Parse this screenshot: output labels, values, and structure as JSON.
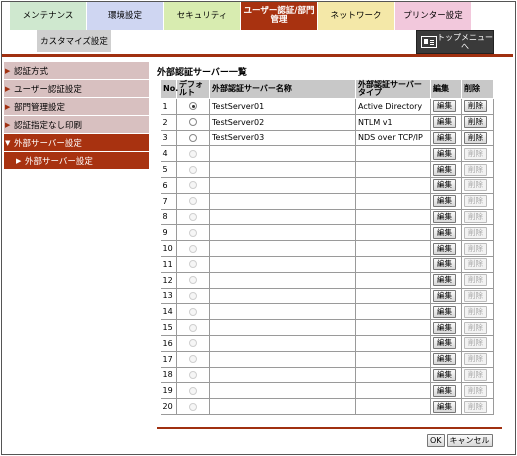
{
  "tabs": [
    {
      "label": "メンテナンス",
      "color": "#cfe8cf",
      "width": 77,
      "active": false
    },
    {
      "label": "環境設定",
      "color": "#cfd6f2",
      "width": 77,
      "active": false
    },
    {
      "label": "セキュリティ",
      "color": "#d8ecb0",
      "width": 77,
      "active": false
    },
    {
      "label": "ユーザー認証/部門\n管理",
      "color": "#a83210",
      "width": 77,
      "active": true
    },
    {
      "label": "ネットワーク",
      "color": "#f4e8a8",
      "width": 77,
      "active": false
    },
    {
      "label": "プリンター設定",
      "color": "#f2c8dc",
      "width": 77,
      "active": false
    }
  ],
  "subtab": {
    "label": "カスタマイズ設定"
  },
  "top_menu": {
    "label": "トップメニュー\nへ"
  },
  "sidebar": {
    "items": [
      {
        "label": "認証方式",
        "arrow": "▶",
        "state": ""
      },
      {
        "label": "ユーザー認証設定",
        "arrow": "▶",
        "state": ""
      },
      {
        "label": "部門管理設定",
        "arrow": "▶",
        "state": ""
      },
      {
        "label": "認証指定なし印刷",
        "arrow": "▶",
        "state": ""
      },
      {
        "label": "外部サーバー設定",
        "arrow": "▼",
        "state": "open"
      },
      {
        "label": "外部サーバー設定",
        "arrow": "▶",
        "state": "sub"
      }
    ]
  },
  "main": {
    "title": "外部認証サーバー一覧",
    "columns": [
      "No.",
      "デフォ\nルト",
      "外部認証サーバー名称",
      "外部認証サーバー\nタイプ",
      "編集",
      "削除"
    ],
    "edit_label": "編集",
    "delete_label": "削除",
    "rows": [
      {
        "no": "1",
        "default": true,
        "name": "TestServer01",
        "type": "Active Directory",
        "enabled": true
      },
      {
        "no": "2",
        "default": false,
        "name": "TestServer02",
        "type": "NTLM v1",
        "enabled": true
      },
      {
        "no": "3",
        "default": false,
        "name": "TestServer03",
        "type": "NDS over TCP/IP",
        "enabled": true
      },
      {
        "no": "4",
        "default": false,
        "name": "",
        "type": "",
        "enabled": false
      },
      {
        "no": "5",
        "default": false,
        "name": "",
        "type": "",
        "enabled": false
      },
      {
        "no": "6",
        "default": false,
        "name": "",
        "type": "",
        "enabled": false
      },
      {
        "no": "7",
        "default": false,
        "name": "",
        "type": "",
        "enabled": false
      },
      {
        "no": "8",
        "default": false,
        "name": "",
        "type": "",
        "enabled": false
      },
      {
        "no": "9",
        "default": false,
        "name": "",
        "type": "",
        "enabled": false
      },
      {
        "no": "10",
        "default": false,
        "name": "",
        "type": "",
        "enabled": false
      },
      {
        "no": "11",
        "default": false,
        "name": "",
        "type": "",
        "enabled": false
      },
      {
        "no": "12",
        "default": false,
        "name": "",
        "type": "",
        "enabled": false
      },
      {
        "no": "13",
        "default": false,
        "name": "",
        "type": "",
        "enabled": false
      },
      {
        "no": "14",
        "default": false,
        "name": "",
        "type": "",
        "enabled": false
      },
      {
        "no": "15",
        "default": false,
        "name": "",
        "type": "",
        "enabled": false
      },
      {
        "no": "16",
        "default": false,
        "name": "",
        "type": "",
        "enabled": false
      },
      {
        "no": "17",
        "default": false,
        "name": "",
        "type": "",
        "enabled": false
      },
      {
        "no": "18",
        "default": false,
        "name": "",
        "type": "",
        "enabled": false
      },
      {
        "no": "19",
        "default": false,
        "name": "",
        "type": "",
        "enabled": false
      },
      {
        "no": "20",
        "default": false,
        "name": "",
        "type": "",
        "enabled": false
      }
    ]
  },
  "footer": {
    "ok_label": "OK",
    "cancel_label": "キャンセル"
  },
  "colors": {
    "accent": "#a83210",
    "sidebar_item": "#d8c0c0",
    "header_bg": "#c8c8c8"
  }
}
